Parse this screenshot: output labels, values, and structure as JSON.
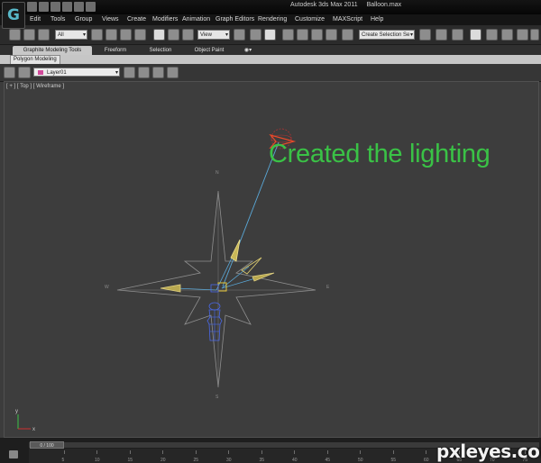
{
  "window": {
    "title": "Autodesk 3ds Max 2011",
    "file": "Balloon.max"
  },
  "menu": [
    "Edit",
    "Tools",
    "Group",
    "Views",
    "Create",
    "Modifiers",
    "Animation",
    "Graph Editors",
    "Rendering",
    "Customize",
    "MAXScript",
    "Help"
  ],
  "toolbar": {
    "filter_value": "All",
    "reference_coord_value": "View",
    "selection_set_value": "Create Selection Se"
  },
  "ribbon": {
    "tabs": [
      "Graphite Modeling Tools",
      "Freeform",
      "Selection",
      "Object Paint"
    ],
    "active_tab": 0,
    "panel_label": "Polygon Modeling"
  },
  "layer": {
    "current_layer": "Layer01",
    "swatch_color": "#d14a9a"
  },
  "viewport": {
    "label": "[ + ] [ Top ] [ Wireframe ]",
    "compass_labels": {
      "north": "N",
      "south": "S",
      "east": "E",
      "west": "W"
    },
    "axis_labels": {
      "y": "y",
      "x": "x"
    }
  },
  "annotation": {
    "text": "Created the lighting",
    "color": "#3ac246"
  },
  "timeline": {
    "frame_readout": "0 / 100",
    "ruler_ticks": [
      "5",
      "10",
      "15",
      "20",
      "25",
      "30",
      "35",
      "40",
      "45",
      "50",
      "55",
      "60",
      "65",
      "70",
      "75"
    ]
  },
  "watermark": "pxleyes.com",
  "icons": [
    "app-logo-icon",
    "select-object-icon",
    "select-by-name-icon",
    "select-move-icon",
    "select-rotate-icon",
    "select-scale-icon",
    "snap-toggle-icon",
    "angle-snap-icon",
    "percent-snap-icon",
    "mirror-icon",
    "align-icon",
    "render-setup-icon",
    "render-icon",
    "material-editor-icon",
    "light-icon",
    "light-target-icon",
    "key-mode-icon"
  ]
}
